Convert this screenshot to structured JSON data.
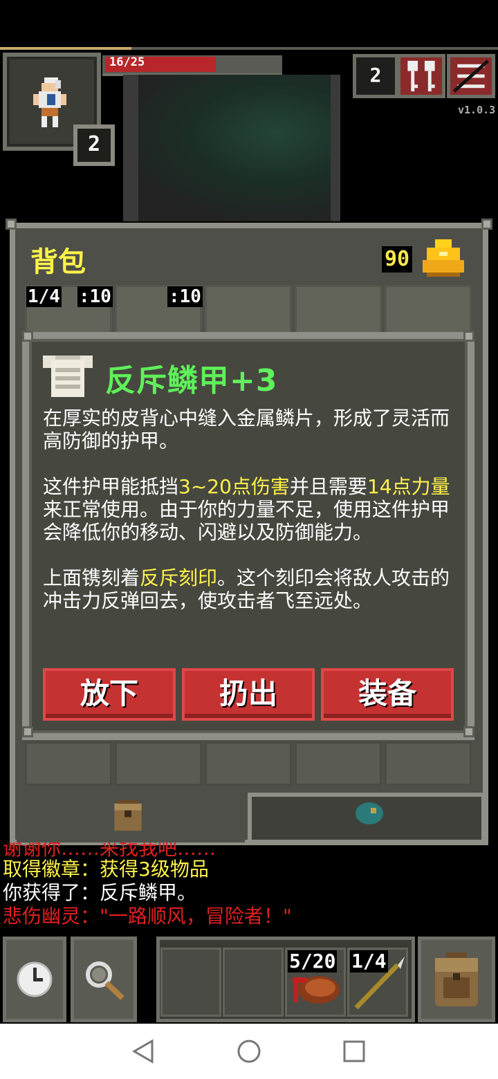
{
  "hud": {
    "hp_text": "16/25",
    "hp_fraction": 0.64,
    "hero_level": "2",
    "depth": "2",
    "version": "v1.0.3",
    "journal_icon": "keys-journal-icon",
    "menu_icon": "menu-icon"
  },
  "backpack": {
    "title": "背包",
    "gold": "90",
    "gold_icon": "gold-pile-icon",
    "slots_top": [
      {
        "count": "1/4",
        "icon": "darts-icon"
      },
      {
        "count": ":10",
        "icon": "throwing-item-icon"
      },
      {
        "count": ":10",
        "icon": "armor-stack-icon"
      },
      {
        "count": "",
        "icon": "empty-weapon-placeholder-icon"
      },
      {
        "count": "",
        "icon": "empty-ring-placeholder-icon"
      },
      {
        "count": "",
        "icon": "empty-artifact-placeholder-icon"
      }
    ],
    "lower_items": [
      {
        "icon": "pouch-icon"
      },
      {
        "icon": "seed-icon"
      }
    ]
  },
  "item": {
    "name": "反斥鳞甲+3",
    "icon": "scale-armor-icon",
    "para1": "在厚实的皮背心中缝入金属鳞片，形成了灵活而高防御的护甲。",
    "p2_a": "这件护甲能抵挡",
    "p2_b": "3~20点伤害",
    "p2_c": "并且需要",
    "p2_d": "14点力量",
    "p2_e": "来正常使用。由于你的力量不足，使用这件护甲会降低你的移动、闪避以及防御能力。",
    "p3_a": "上面镌刻着",
    "p3_b": "反斥刻印",
    "p3_c": "。这个刻印会将敌人攻击的冲击力反弹回去，使攻击者飞至远处。",
    "buttons": {
      "drop": "放下",
      "throw": "扔出",
      "equip": "装备"
    }
  },
  "log": {
    "line0": "谢谢你……来找我吧……",
    "line1": "取得徽章：获得3级物品",
    "line2": "你获得了：反斥鳞甲。",
    "line3": "悲伤幽灵：\"一路顺风，冒险者！\""
  },
  "toolbar": {
    "wait_icon": "clock-icon",
    "search_icon": "magnifier-icon",
    "quickslots": [
      {
        "count": "",
        "icon": ""
      },
      {
        "count": "",
        "icon": ""
      },
      {
        "count": "5/20",
        "icon": "meat-icon"
      },
      {
        "count": "1/4",
        "icon": "dart-icon"
      }
    ],
    "inventory_icon": "backpack-icon"
  },
  "navbar": {
    "back_icon": "back-triangle-icon",
    "home_icon": "home-circle-icon",
    "recents_icon": "recents-square-icon"
  },
  "colors": {
    "highlight": "#fff34a",
    "item_name": "#5ff05a",
    "button": "#c53232",
    "log_red": "#e02020",
    "log_yellow": "#fff34a"
  }
}
